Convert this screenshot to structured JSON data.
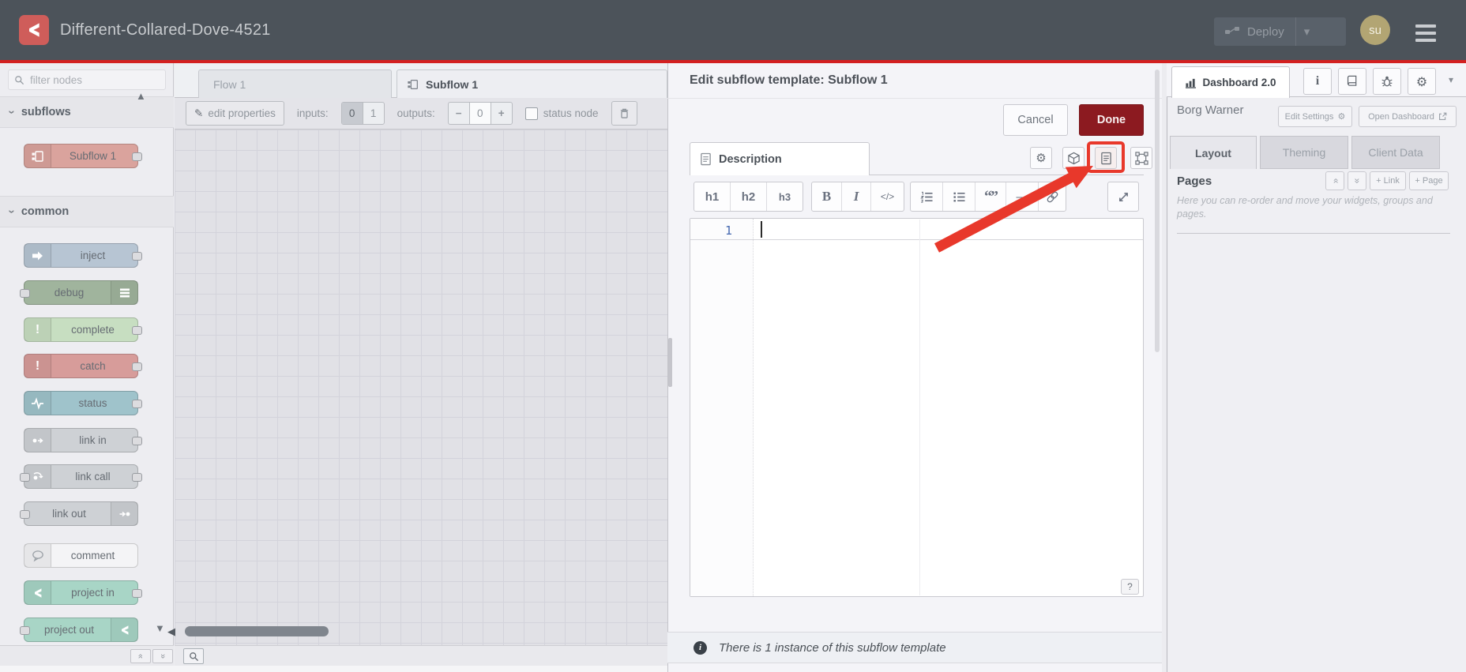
{
  "header": {
    "title": "Different-Collared-Dove-4521",
    "deploy_label": "Deploy",
    "avatar_initials": "su"
  },
  "icons": {
    "chevron": "›",
    "caret_down": "▾",
    "double_chevron": "»",
    "up_triangle": "▲",
    "down_triangle": "▼",
    "left_triangle": "◀",
    "gear": "⚙",
    "pencil": "✎",
    "quote": "“”",
    "hr": "—",
    "info": "i"
  },
  "palette": {
    "filter_placeholder": "filter nodes",
    "categories": [
      {
        "label": "subflows",
        "nodes": [
          {
            "label": "Subflow 1",
            "color": "#daa39d"
          }
        ]
      },
      {
        "label": "common",
        "nodes": [
          {
            "label": "inject",
            "color": "#b7c5d3"
          },
          {
            "label": "debug",
            "color": "#a0b49d"
          },
          {
            "label": "complete",
            "color": "#c7dec1"
          },
          {
            "label": "catch",
            "color": "#d79c9a"
          },
          {
            "label": "status",
            "color": "#9fc3cb"
          },
          {
            "label": "link in",
            "color": "#ced1d5"
          },
          {
            "label": "link call",
            "color": "#ced1d5"
          },
          {
            "label": "link out",
            "color": "#ced1d5"
          },
          {
            "label": "comment",
            "color": "#f4f4f6"
          },
          {
            "label": "project in",
            "color": "#a8d5c6"
          },
          {
            "label": "project out",
            "color": "#a8d5c6"
          }
        ]
      }
    ]
  },
  "workspace": {
    "tabs": [
      {
        "label": "Flow 1"
      },
      {
        "label": "Subflow 1"
      }
    ],
    "toolbar": {
      "edit_properties": "edit properties",
      "inputs_label": "inputs:",
      "inputs_options": [
        "0",
        "1"
      ],
      "outputs_label": "outputs:",
      "outputs_minus": "−",
      "outputs_value": "0",
      "outputs_plus": "+",
      "status_node_label": "status node"
    }
  },
  "tray": {
    "title": "Edit subflow template: Subflow 1",
    "cancel_label": "Cancel",
    "done_label": "Done",
    "tab_label": "Description",
    "md_toolbar": {
      "h1": "h1",
      "h2": "h2",
      "h3": "h3",
      "bold": "B",
      "italic": "I",
      "code": "</>"
    },
    "editor": {
      "line_number": "1",
      "content": ""
    },
    "help_button": "?",
    "footer_text": "There is 1 instance of this subflow template"
  },
  "sidebar": {
    "tab_label": "Dashboard 2.0",
    "owner": "Borg Warner",
    "edit_settings_label": "Edit Settings",
    "open_dashboard_label": "Open Dashboard",
    "tabs": [
      "Layout",
      "Theming",
      "Client Data"
    ],
    "active_tab": "Layout",
    "pages": {
      "title": "Pages",
      "add_link_label": "+ Link",
      "add_page_label": "+ Page",
      "help_text": "Here you can re-order and move your widgets, groups and pages."
    }
  },
  "annotation": {
    "color": "#e8382b"
  }
}
